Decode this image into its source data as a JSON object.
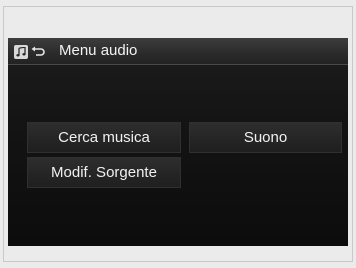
{
  "header": {
    "title": "Menu audio",
    "icons": [
      "music-note-icon",
      "back-arrow-icon"
    ]
  },
  "menu": {
    "items": [
      {
        "label": "Cerca musica"
      },
      {
        "label": "Suono"
      },
      {
        "label": "Modif. Sorgente"
      }
    ]
  },
  "colors": {
    "screen_background": "#141414",
    "header_background": "#2c2c2c",
    "button_background": "#262626",
    "text": "#f0f0f0"
  }
}
